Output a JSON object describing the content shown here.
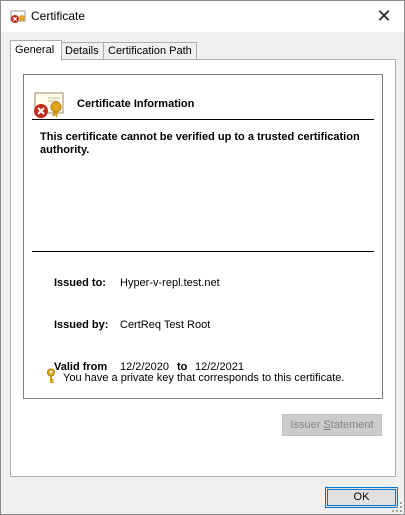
{
  "window": {
    "title": "Certificate",
    "close_glyph": "✕"
  },
  "tabs": [
    {
      "label": "General"
    },
    {
      "label": "Details"
    },
    {
      "label": "Certification Path"
    }
  ],
  "general": {
    "info_title": "Certificate Information",
    "warning": "This certificate cannot be verified up to a trusted certification authority.",
    "issued_to_label": "Issued to:",
    "issued_to_value": "Hyper-v-repl.test.net",
    "issued_by_label": "Issued by:",
    "issued_by_value": "CertReq Test Root",
    "valid_from_label": "Valid from",
    "valid_from_value": "12/2/2020",
    "valid_to_label": "to",
    "valid_to_value": "12/2/2021",
    "private_key_text": "You have a private key that corresponds to this certificate.",
    "issuer_statement_label": "Issuer Statement",
    "issuer_statement_mnemonic": "S"
  },
  "footer": {
    "ok_label": "OK"
  },
  "icons": {
    "title": "certificate-error-icon",
    "cert": "certificate-error-icon",
    "key": "key-icon",
    "close": "close-icon"
  },
  "colors": {
    "accent": "#0078d7",
    "error_red": "#c42b1c",
    "ribbon_gold": "#e0a81a"
  }
}
